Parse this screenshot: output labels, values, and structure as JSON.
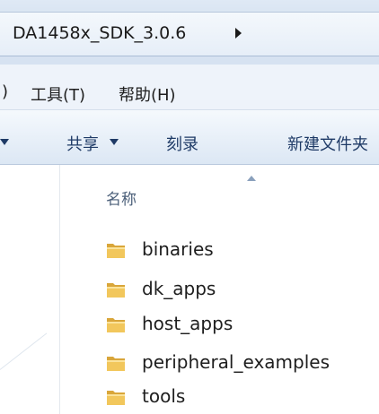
{
  "address_bar": {
    "crumb": "DA1458x_SDK_3.0.6"
  },
  "menu": {
    "partial": ")",
    "tools": "工具(T)",
    "help": "帮助(H)"
  },
  "command_bar": {
    "share": "共享",
    "burn": "刻录",
    "new_folder": "新建文件夹"
  },
  "list": {
    "column_name": "名称",
    "items": [
      "binaries",
      "dk_apps",
      "host_apps",
      "peripheral_examples",
      "tools"
    ]
  },
  "colors": {
    "folder": "#e8b84a",
    "accent": "#1e3a66"
  }
}
